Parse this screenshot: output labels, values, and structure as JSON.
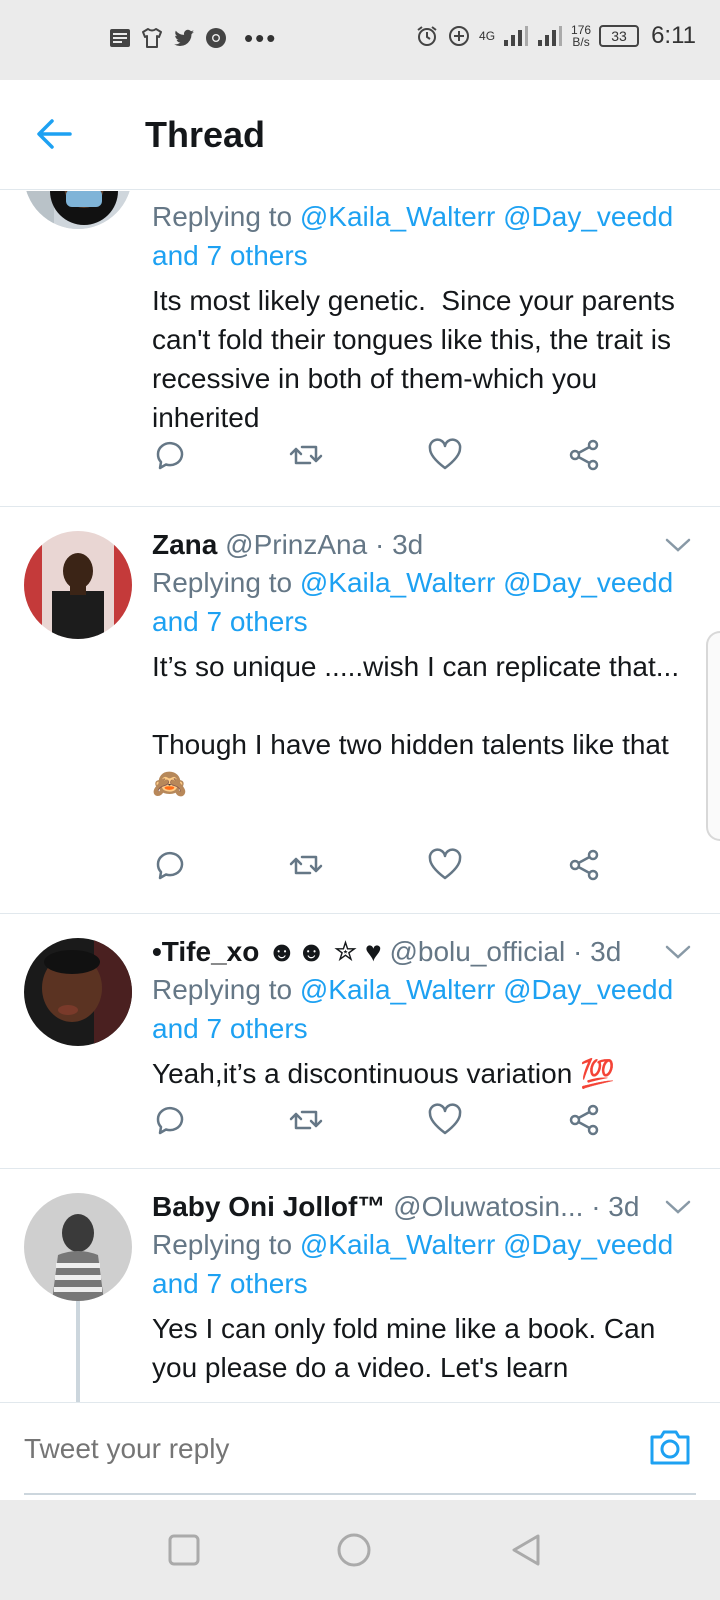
{
  "status_bar": {
    "network": "4G",
    "speed_value": "176",
    "speed_unit": "B/s",
    "battery": "33",
    "time": "6:11"
  },
  "header": {
    "title": "Thread"
  },
  "tweets": [
    {
      "name": "",
      "handle": "",
      "time": "",
      "replying_prefix": "Replying to ",
      "reply_to_1": "@Kaila_Walterr",
      "reply_to_2": "@Day_veedd",
      "reply_others": "and 7 others",
      "text": "Its most likely genetic.  Since your parents can't fold their tongues like this, the trait is recessive in both of them-which you inherited",
      "emoji": ""
    },
    {
      "name": "Zana",
      "handle": "@PrinzAna",
      "time": " · 3d",
      "replying_prefix": "Replying to ",
      "reply_to_1": "@Kaila_Walterr",
      "reply_to_2": "@Day_veedd",
      "reply_others": "and 7 others",
      "text": "It’s so unique .....wish I can replicate that...\n\nThough I have two hidden talents like that ",
      "emoji": "🙈"
    },
    {
      "name": "•Tife_xo ☻☻ ✮ ♥",
      "handle": "@bolu_official",
      "time": " · 3d",
      "replying_prefix": "Replying to ",
      "reply_to_1": "@Kaila_Walterr",
      "reply_to_2": "@Day_veedd",
      "reply_others": "and 7 others",
      "text": "Yeah,it’s a discontinuous variation ",
      "emoji": "💯"
    },
    {
      "name": "Baby Oni Jollof™",
      "handle": "@Oluwatosin...",
      "time": " · 3d",
      "replying_prefix": "Replying to ",
      "reply_to_1": "@Kaila_Walterr",
      "reply_to_2": "@Day_veedd",
      "reply_others": "and 7 others",
      "text": "Yes I can only fold mine like a book. Can you please do a video. Let's learn",
      "emoji": ""
    }
  ],
  "reply_bar": {
    "placeholder": "Tweet your reply"
  },
  "colors": {
    "accent": "#1da1f2",
    "text": "#14171a",
    "secondary": "#657786",
    "divider": "#e1e8ed"
  },
  "icons": {
    "back": "arrow-left-icon",
    "reply": "speech-bubble-icon",
    "retweet": "retweet-icon",
    "like": "heart-icon",
    "share": "share-icon",
    "camera": "camera-icon"
  }
}
